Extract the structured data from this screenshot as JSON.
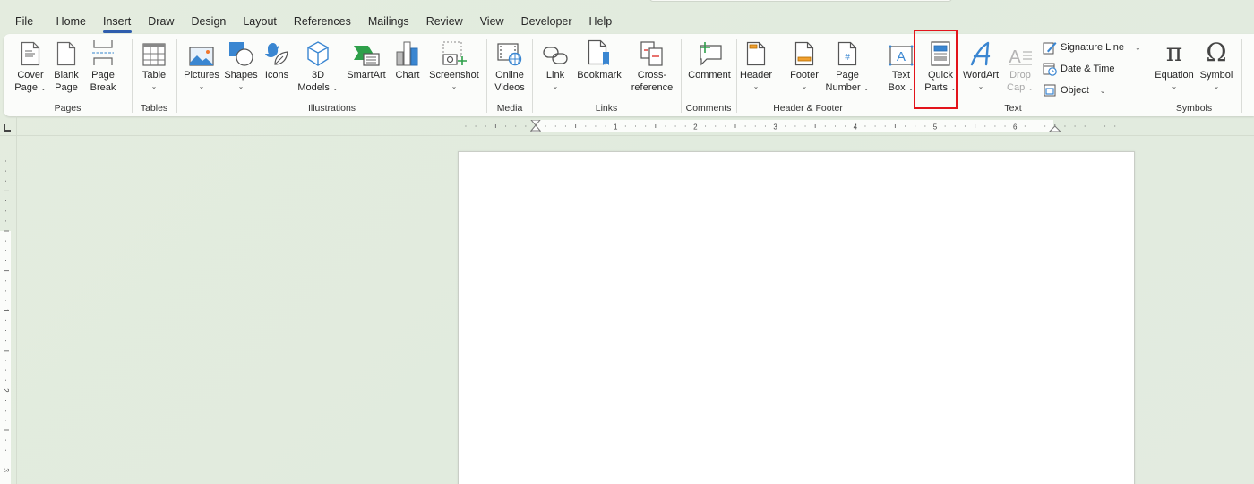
{
  "tabs": [
    {
      "label": "File",
      "active": false
    },
    {
      "label": "Home",
      "active": false
    },
    {
      "label": "Insert",
      "active": true
    },
    {
      "label": "Draw",
      "active": false
    },
    {
      "label": "Design",
      "active": false
    },
    {
      "label": "Layout",
      "active": false
    },
    {
      "label": "References",
      "active": false
    },
    {
      "label": "Mailings",
      "active": false
    },
    {
      "label": "Review",
      "active": false
    },
    {
      "label": "View",
      "active": false
    },
    {
      "label": "Developer",
      "active": false
    },
    {
      "label": "Help",
      "active": false
    }
  ],
  "ribbon": {
    "pages": {
      "label": "Pages",
      "cover_page": {
        "line1": "Cover",
        "line2": "Page",
        "icon": "cover-page-icon"
      },
      "blank_page": {
        "line1": "Blank",
        "line2": "Page",
        "icon": "blank-page-icon"
      },
      "page_break": {
        "line1": "Page",
        "line2": "Break",
        "icon": "page-break-icon"
      }
    },
    "tables": {
      "label": "Tables",
      "table": {
        "line1": "Table",
        "icon": "table-icon"
      }
    },
    "illustrations": {
      "label": "Illustrations",
      "pictures": {
        "line1": "Pictures",
        "icon": "pictures-icon"
      },
      "shapes": {
        "line1": "Shapes",
        "icon": "shapes-icon"
      },
      "icons": {
        "line1": "Icons",
        "icon": "icons-icon"
      },
      "models3d": {
        "line1": "3D",
        "line2": "Models",
        "icon": "3d-models-icon"
      },
      "smartart": {
        "line1": "SmartArt",
        "icon": "smartart-icon"
      },
      "chart": {
        "line1": "Chart",
        "icon": "chart-icon"
      },
      "screenshot": {
        "line1": "Screenshot",
        "icon": "screenshot-icon"
      }
    },
    "media": {
      "label": "Media",
      "online_videos": {
        "line1": "Online",
        "line2": "Videos",
        "icon": "online-videos-icon"
      }
    },
    "links": {
      "label": "Links",
      "link": {
        "line1": "Link",
        "icon": "link-icon"
      },
      "bookmark": {
        "line1": "Bookmark",
        "icon": "bookmark-icon"
      },
      "cross_reference": {
        "line1": "Cross-",
        "line2": "reference",
        "icon": "cross-reference-icon"
      }
    },
    "comments": {
      "label": "Comments",
      "comment": {
        "line1": "Comment",
        "icon": "comment-icon"
      }
    },
    "header_footer": {
      "label": "Header & Footer",
      "header": {
        "line1": "Header",
        "icon": "header-icon"
      },
      "footer": {
        "line1": "Footer",
        "icon": "footer-icon"
      },
      "page_number": {
        "line1": "Page",
        "line2": "Number",
        "icon": "page-number-icon"
      }
    },
    "text": {
      "label": "Text",
      "text_box": {
        "line1": "Text",
        "line2": "Box",
        "icon": "text-box-icon"
      },
      "quick_parts": {
        "line1": "Quick",
        "line2": "Parts",
        "icon": "quick-parts-icon",
        "highlighted": true
      },
      "wordart": {
        "line1": "WordArt",
        "icon": "wordart-icon"
      },
      "drop_cap": {
        "line1": "Drop",
        "line2": "Cap",
        "icon": "drop-cap-icon",
        "disabled": true
      },
      "signature_line": {
        "label": "Signature Line",
        "icon": "signature-line-icon"
      },
      "date_time": {
        "label": "Date & Time",
        "icon": "date-time-icon"
      },
      "object": {
        "label": "Object",
        "icon": "object-icon"
      }
    },
    "symbols": {
      "label": "Symbols",
      "equation": {
        "line1": "Equation",
        "icon": "equation-icon",
        "glyph": "π"
      },
      "symbol": {
        "line1": "Symbol",
        "icon": "symbol-icon",
        "glyph": "Ω"
      }
    }
  },
  "ruler": {
    "numbers": [
      "1",
      "2",
      "3",
      "4",
      "5",
      "6"
    ],
    "vertical_numbers": [
      "1",
      "2",
      "3"
    ]
  },
  "colors": {
    "accent_blue": "#2f5dad",
    "highlight_red": "#e3141b",
    "icon_blue": "#3a86d1",
    "icon_orange": "#f0a030",
    "icon_green": "#2ea04a"
  }
}
